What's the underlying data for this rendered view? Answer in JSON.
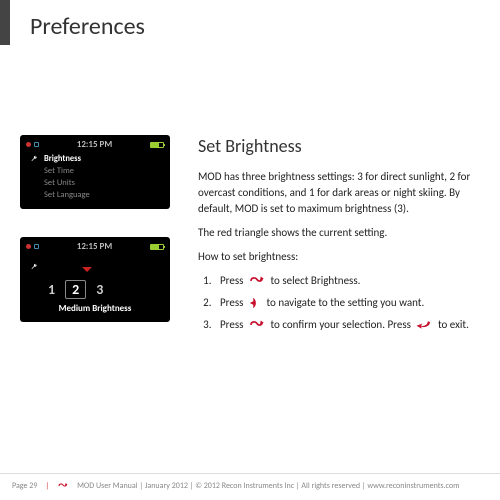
{
  "header": {
    "title": "Preferences"
  },
  "section": {
    "title": "Set Brightness",
    "paragraphs": [
      "MOD has three brightness settings: 3 for direct sunlight, 2 for overcast conditions, and 1 for dark areas or night skiing. By default, MOD is set to maximum brightness (3).",
      "The red triangle shows the current setting.",
      "How to set brightness:"
    ],
    "steps": [
      {
        "before": "Press",
        "after": "to select Brightness."
      },
      {
        "before": "Press",
        "after": "to navigate to the setting you want."
      },
      {
        "before": "Press",
        "mid": "to confirm your selection. Press",
        "after": "to exit."
      }
    ]
  },
  "device1": {
    "time": "12:15 PM",
    "items": [
      "Brightness",
      "Set Time",
      "Set Units",
      "Set Language"
    ]
  },
  "device2": {
    "time": "12:15 PM",
    "nums": [
      "1",
      "2",
      "3"
    ],
    "label": "Medium Brightness"
  },
  "footer": {
    "page": "Page 29",
    "text": "MOD User Manual | January 2012 | © 2012 Recon Instruments Inc | All rights reserved | www.reconinstruments.com"
  }
}
